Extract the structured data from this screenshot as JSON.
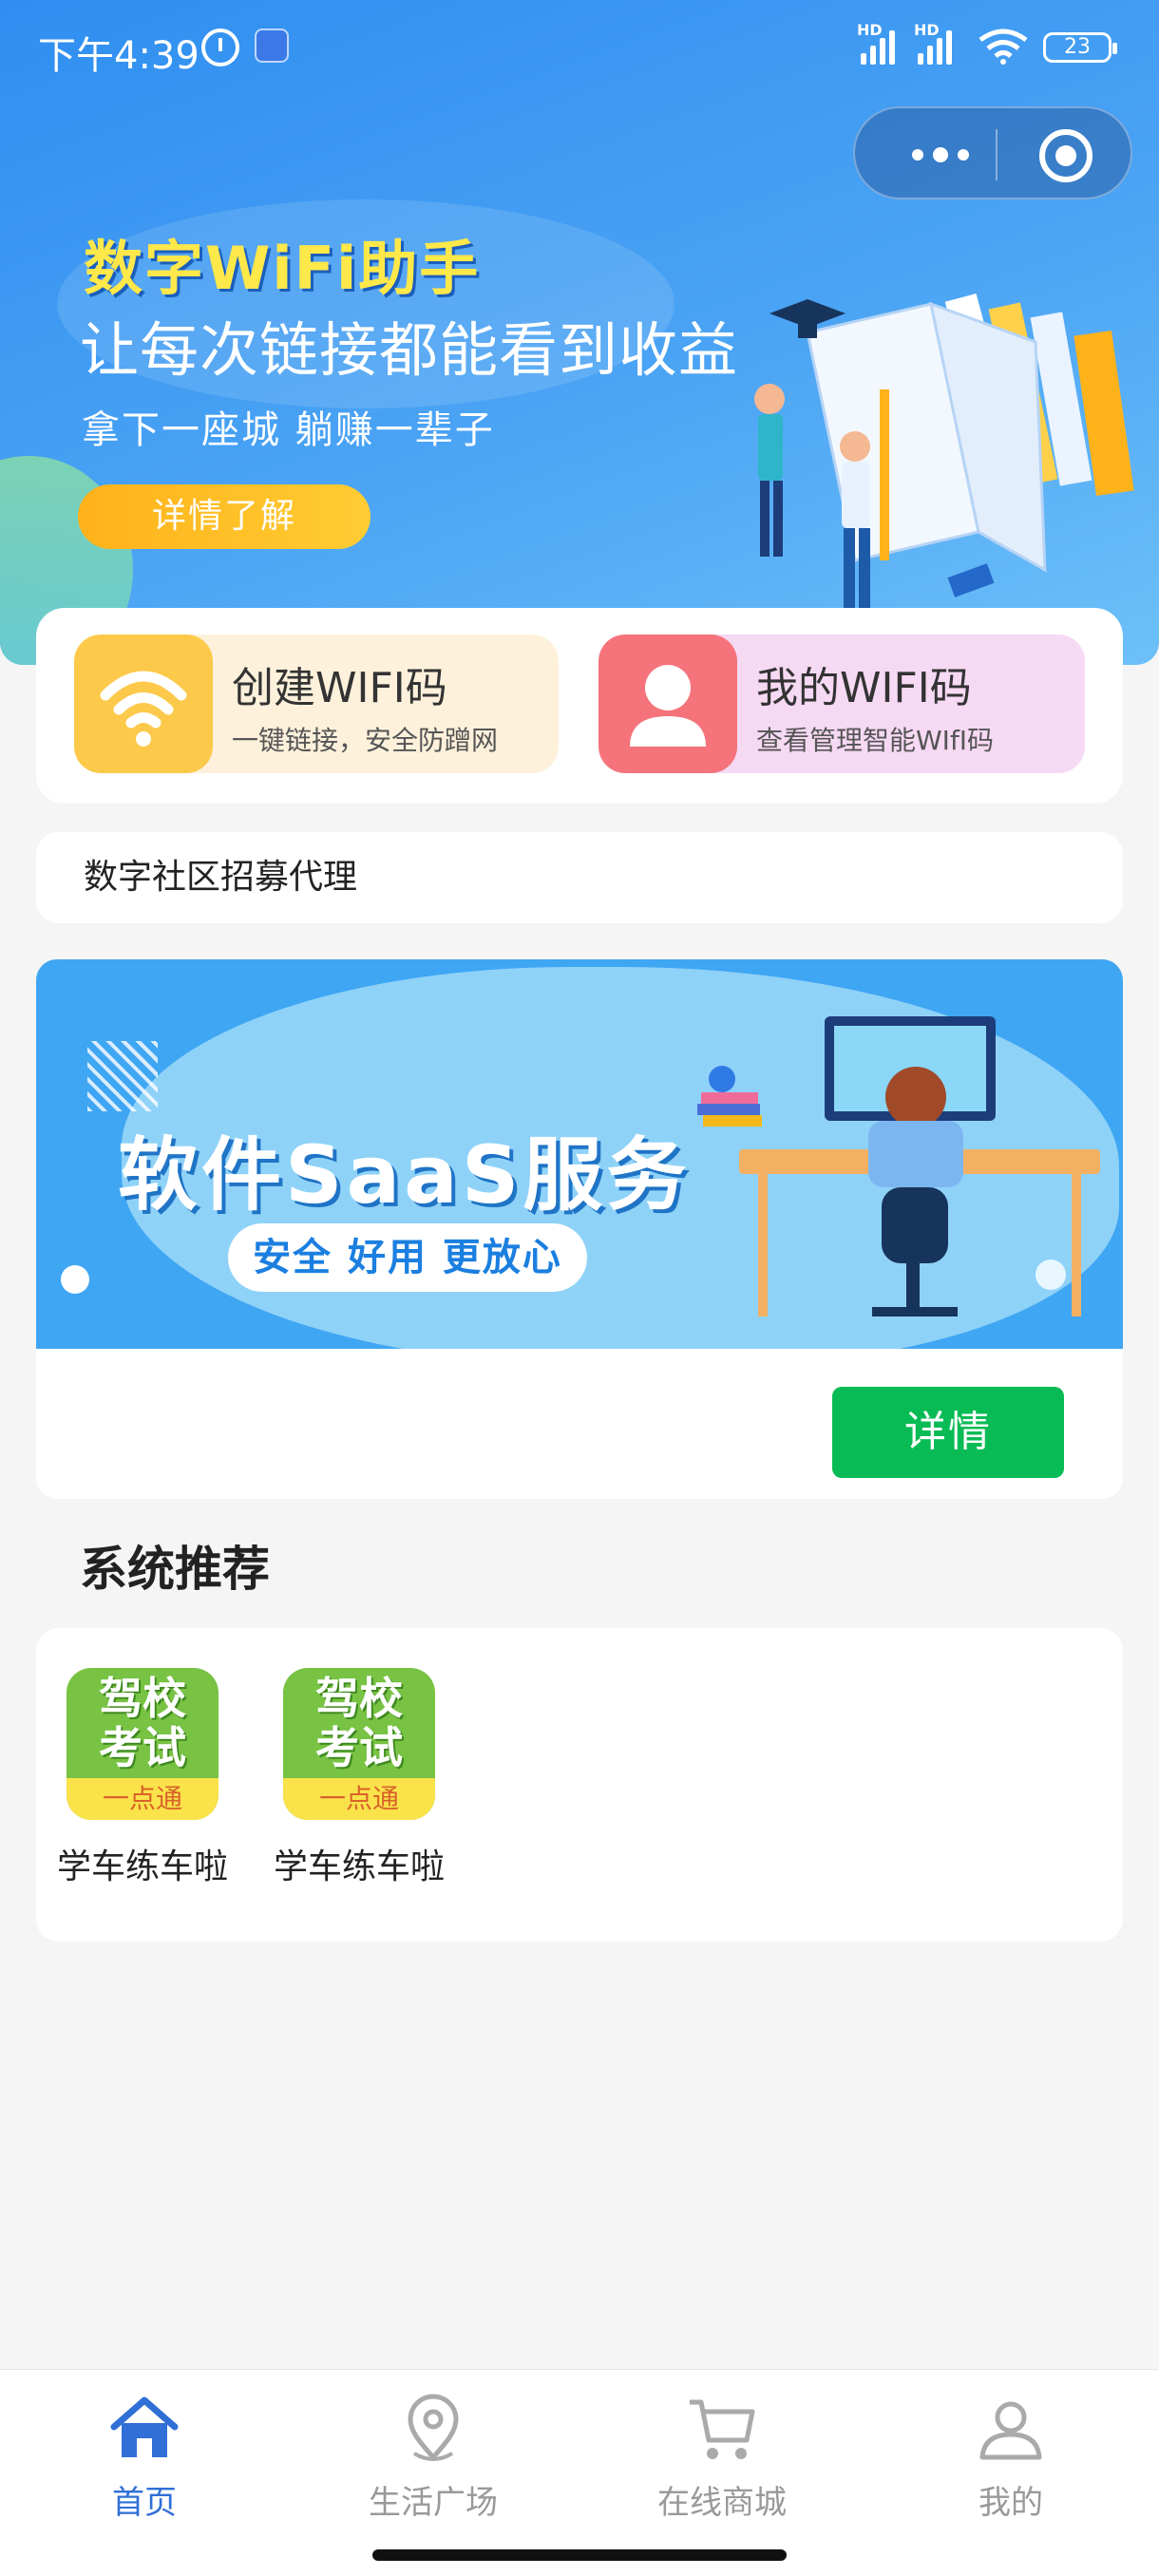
{
  "status_bar": {
    "time": "下午4:39",
    "hd1": "HD",
    "hd2": "HD",
    "battery": "23"
  },
  "capsule": {
    "more_icon": "more-dots-icon",
    "close_icon": "target-circle-icon"
  },
  "hero": {
    "title": "数字WiFi助手",
    "subtitle": "让每次链接都能看到收益",
    "slogan": "拿下一座城 躺赚一辈子",
    "button": "详情了解"
  },
  "actions": [
    {
      "title": "创建WIFI码",
      "desc": "一键链接，安全防蹭网",
      "icon": "wifi-icon",
      "color": "#fcc94a"
    },
    {
      "title": "我的WIFI码",
      "desc": "查看管理智能WIfI码",
      "icon": "user-icon",
      "color": "#f5737a"
    }
  ],
  "notice": "数字社区招募代理",
  "saas_banner": {
    "title": "软件SaaS服务",
    "pill": "安全 好用 更放心",
    "detail_button": "详情"
  },
  "section_title": "系统推荐",
  "apps": [
    {
      "logo_line1": "驾校",
      "logo_line2": "考试",
      "logo_line3": "一点通",
      "name": "学车练车啦"
    },
    {
      "logo_line1": "驾校",
      "logo_line2": "考试",
      "logo_line3": "一点通",
      "name": "学车练车啦"
    }
  ],
  "tabbar": [
    {
      "label": "首页",
      "icon": "home-icon",
      "active": true
    },
    {
      "label": "生活广场",
      "icon": "location-pin-icon",
      "active": false
    },
    {
      "label": "在线商城",
      "icon": "cart-icon",
      "active": false
    },
    {
      "label": "我的",
      "icon": "person-icon",
      "active": false
    }
  ],
  "colors": {
    "accent": "#2f6fd6",
    "green": "#09bb55",
    "hero_yellow": "#ffe84a",
    "background": "#f5f5f5"
  }
}
